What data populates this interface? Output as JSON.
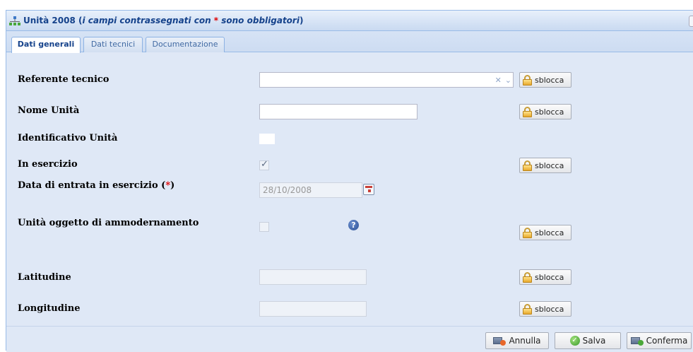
{
  "panel": {
    "title_prefix": "Unità 2008 (",
    "title_note_a": "i campi contrassegnati con ",
    "title_star": "*",
    "title_note_b": " sono obbligatori",
    "title_suffix": ")",
    "icon": "network-tree-icon"
  },
  "tabs": [
    {
      "label": "Dati generali",
      "active": true
    },
    {
      "label": "Dati tecnici",
      "active": false
    },
    {
      "label": "Documentazione",
      "active": false
    }
  ],
  "form": {
    "referente_label": "Referente tecnico",
    "referente_value": "",
    "clear_glyph": "✕",
    "dropdown_glyph": "⌄",
    "nome_label": "Nome Unità",
    "nome_value": "",
    "identificativo_label": "Identificativo Unità",
    "in_esercizio_label": "In esercizio",
    "in_esercizio_checked": true,
    "checkmark_glyph": "✓",
    "data_label": "Data di entrata in esercizio (",
    "data_req": "*",
    "data_label_end": ")",
    "data_value": "28/10/2008",
    "ammodernamento_label": "Unità oggetto di ammodernamento",
    "ammodernamento_checked": false,
    "help_glyph": "?",
    "latitudine_label": "Latitudine",
    "latitudine_value": "",
    "longitudine_label": "Longitudine",
    "longitudine_value": "",
    "sblocca_label": "sblocca"
  },
  "footer": {
    "annulla_label": "Annulla",
    "salva_label": "Salva",
    "conferma_label": "Conferma"
  },
  "colors": {
    "panel_bg": "#dfe8f6",
    "title_text": "#15428b",
    "required": "#e00000"
  }
}
